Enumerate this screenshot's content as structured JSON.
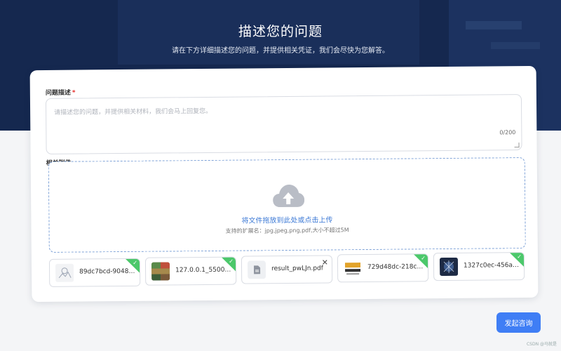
{
  "header": {
    "title": "描述您的问题",
    "subtitle": "请在下方详细描述您的问题，并提供相关凭证，我们会尽快为您解答。"
  },
  "form": {
    "description_label": "问题描述",
    "required_mark": "*",
    "description_placeholder": "请描述您的问题，并提供相关材料，我们会马上回复您。",
    "char_count": "0/200",
    "attachments_label": "相关附件"
  },
  "upload": {
    "main_text": "将文件拖放到此处或点击上传",
    "hint": "支持的扩展名：jpg,jpeg,png,pdf,大小不超过5M"
  },
  "files": [
    {
      "name": "89dc7bcd-9048…",
      "status": "uploaded"
    },
    {
      "name": "127.0.0.1_5500…",
      "status": "uploaded"
    },
    {
      "name": "result_pwLJn.pdf",
      "status": "removable"
    },
    {
      "name": "729d48dc-218c…",
      "status": "uploaded"
    },
    {
      "name": "1327c0ec-456a…",
      "status": "uploaded"
    }
  ],
  "submit_label": "发起咨询",
  "watermark": "CSDN @马就是",
  "colors": {
    "hero_bg": "#15284f",
    "accent": "#3f7ef5",
    "success": "#4cc86b",
    "required": "#e53935"
  }
}
